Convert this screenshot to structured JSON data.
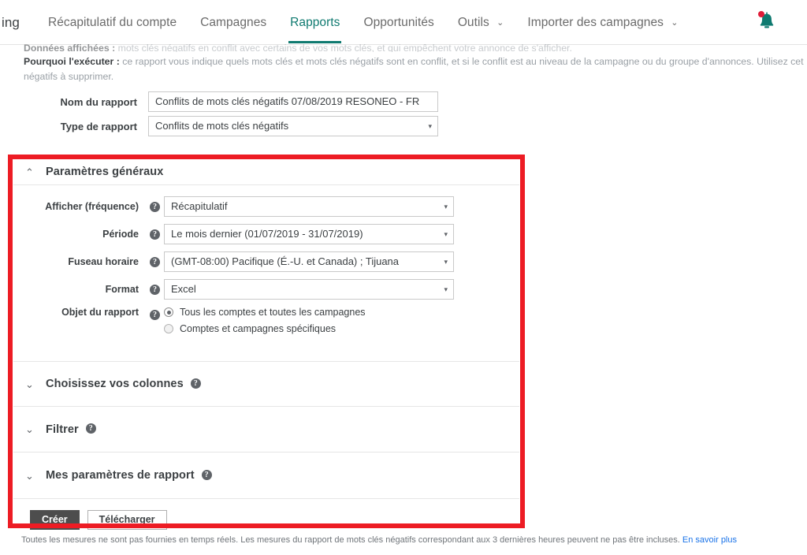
{
  "nav": {
    "brand_fragment": "ing",
    "items": [
      {
        "label": "Récapitulatif du compte",
        "active": false,
        "caret": false
      },
      {
        "label": "Campagnes",
        "active": false,
        "caret": false
      },
      {
        "label": "Rapports",
        "active": true,
        "caret": false
      },
      {
        "label": "Opportunités",
        "active": false,
        "caret": false
      },
      {
        "label": "Outils",
        "active": false,
        "caret": true
      },
      {
        "label": "Importer des campagnes",
        "active": false,
        "caret": true
      }
    ],
    "caret_glyph": "⌄",
    "notifications_icon": "bell-icon",
    "accent_color": "#0f7a70"
  },
  "intro": {
    "line1_lead": "Données affichées :",
    "line1_text": " mots clés négatifs en conflit avec certains de vos mots clés, et qui empêchent votre annonce de s'afficher.",
    "line2_lead": "Pourquoi l'exécuter :",
    "line2_text": " ce rapport vous indique quels mots clés et mots clés négatifs sont en conflit, et si le conflit est au niveau de la campagne ou du groupe d'annonces. Utilisez cet",
    "line3_text": "négatifs à supprimer."
  },
  "report": {
    "name_label": "Nom du rapport",
    "name_value": "Conflits de mots clés négatifs 07/08/2019 RESONEO - FR",
    "type_label": "Type de rapport",
    "type_value": "Conflits de mots clés négatifs"
  },
  "sections": {
    "general": {
      "title": "Paramètres généraux",
      "expanded": true,
      "chevron": "⌃",
      "fields": [
        {
          "label": "Afficher (fréquence)",
          "value": "Récapitulatif",
          "help": "?"
        },
        {
          "label": "Période",
          "value": "Le mois dernier (01/07/2019 - 31/07/2019)",
          "help": "?"
        },
        {
          "label": "Fuseau horaire",
          "value": "(GMT-08:00) Pacifique (É.-U. et Canada) ; Tijuana",
          "help": "?"
        },
        {
          "label": "Format",
          "value": "Excel",
          "help": "?"
        }
      ],
      "scope": {
        "label": "Objet du rapport",
        "help": "?",
        "options": [
          {
            "label": "Tous les comptes et toutes les campagnes",
            "checked": true
          },
          {
            "label": "Comptes et campagnes spécifiques",
            "checked": false
          }
        ]
      }
    },
    "collapsed": [
      {
        "title": "Choisissez vos colonnes",
        "chevron": "⌄",
        "help": "?"
      },
      {
        "title": "Filtrer",
        "chevron": "⌄",
        "help": "?"
      },
      {
        "title": "Mes paramètres de rapport",
        "chevron": "⌄",
        "help": "?"
      }
    ]
  },
  "actions": {
    "create_label": "Créer",
    "download_label": "Télécharger"
  },
  "footer": {
    "note": "Toutes les mesures ne sont pas fournies en temps réels. Les mesures du rapport de mots clés négatifs correspondant aux 3 dernières heures peuvent ne pas être incluses. ",
    "link": "En savoir plus"
  },
  "highlight": {
    "color": "#ed1c24"
  },
  "icons": {
    "dropdown_arrow": "▾"
  }
}
